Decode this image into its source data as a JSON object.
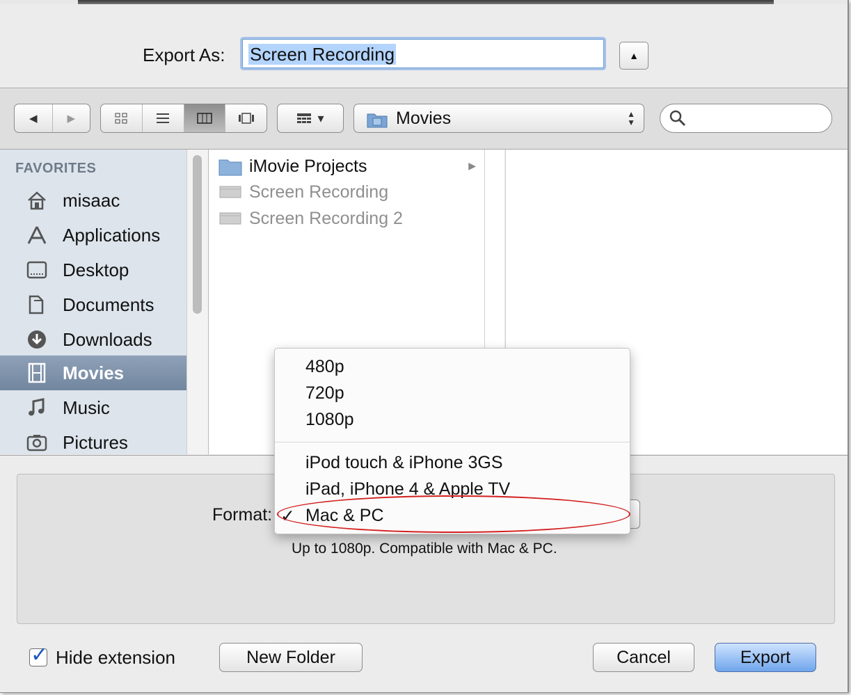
{
  "export_as": {
    "label": "Export As:",
    "filename": "Screen Recording"
  },
  "toolbar": {
    "back": "◀",
    "forward": "▶",
    "views": [
      "icon-view",
      "list-view",
      "column-view",
      "coverflow-view"
    ],
    "arrange_caret": "▾",
    "location": "Movies",
    "search_placeholder": ""
  },
  "sidebar": {
    "heading": "FAVORITES",
    "items": [
      {
        "label": "misaac",
        "icon": "home-icon"
      },
      {
        "label": "Applications",
        "icon": "applications-icon"
      },
      {
        "label": "Desktop",
        "icon": "desktop-icon"
      },
      {
        "label": "Documents",
        "icon": "documents-icon"
      },
      {
        "label": "Downloads",
        "icon": "downloads-icon"
      },
      {
        "label": "Movies",
        "icon": "movies-icon",
        "selected": true
      },
      {
        "label": "Music",
        "icon": "music-icon"
      },
      {
        "label": "Pictures",
        "icon": "pictures-icon"
      }
    ]
  },
  "files": [
    {
      "name": "iMovie Projects",
      "type": "folder"
    },
    {
      "name": "Screen Recording",
      "type": "movie"
    },
    {
      "name": "Screen Recording 2",
      "type": "movie"
    }
  ],
  "format": {
    "label": "Format:",
    "description": "Up to 1080p. Compatible with Mac & PC.",
    "check": "✓",
    "menu_group1": [
      "480p",
      "720p",
      "1080p"
    ],
    "menu_group2": [
      "iPod touch & iPhone 3GS",
      "iPad, iPhone 4 & Apple TV",
      "Mac & PC"
    ],
    "selected": "Mac & PC"
  },
  "hide_extension": {
    "label": "Hide extension",
    "checked": true
  },
  "buttons": {
    "new_folder": "New Folder",
    "cancel": "Cancel",
    "export": "Export"
  },
  "colors": {
    "accent": "#6fa6ec",
    "sidebar_bg": "#dde4ec",
    "sidebar_selected": "#7f93ab",
    "annotation": "#d42020"
  }
}
